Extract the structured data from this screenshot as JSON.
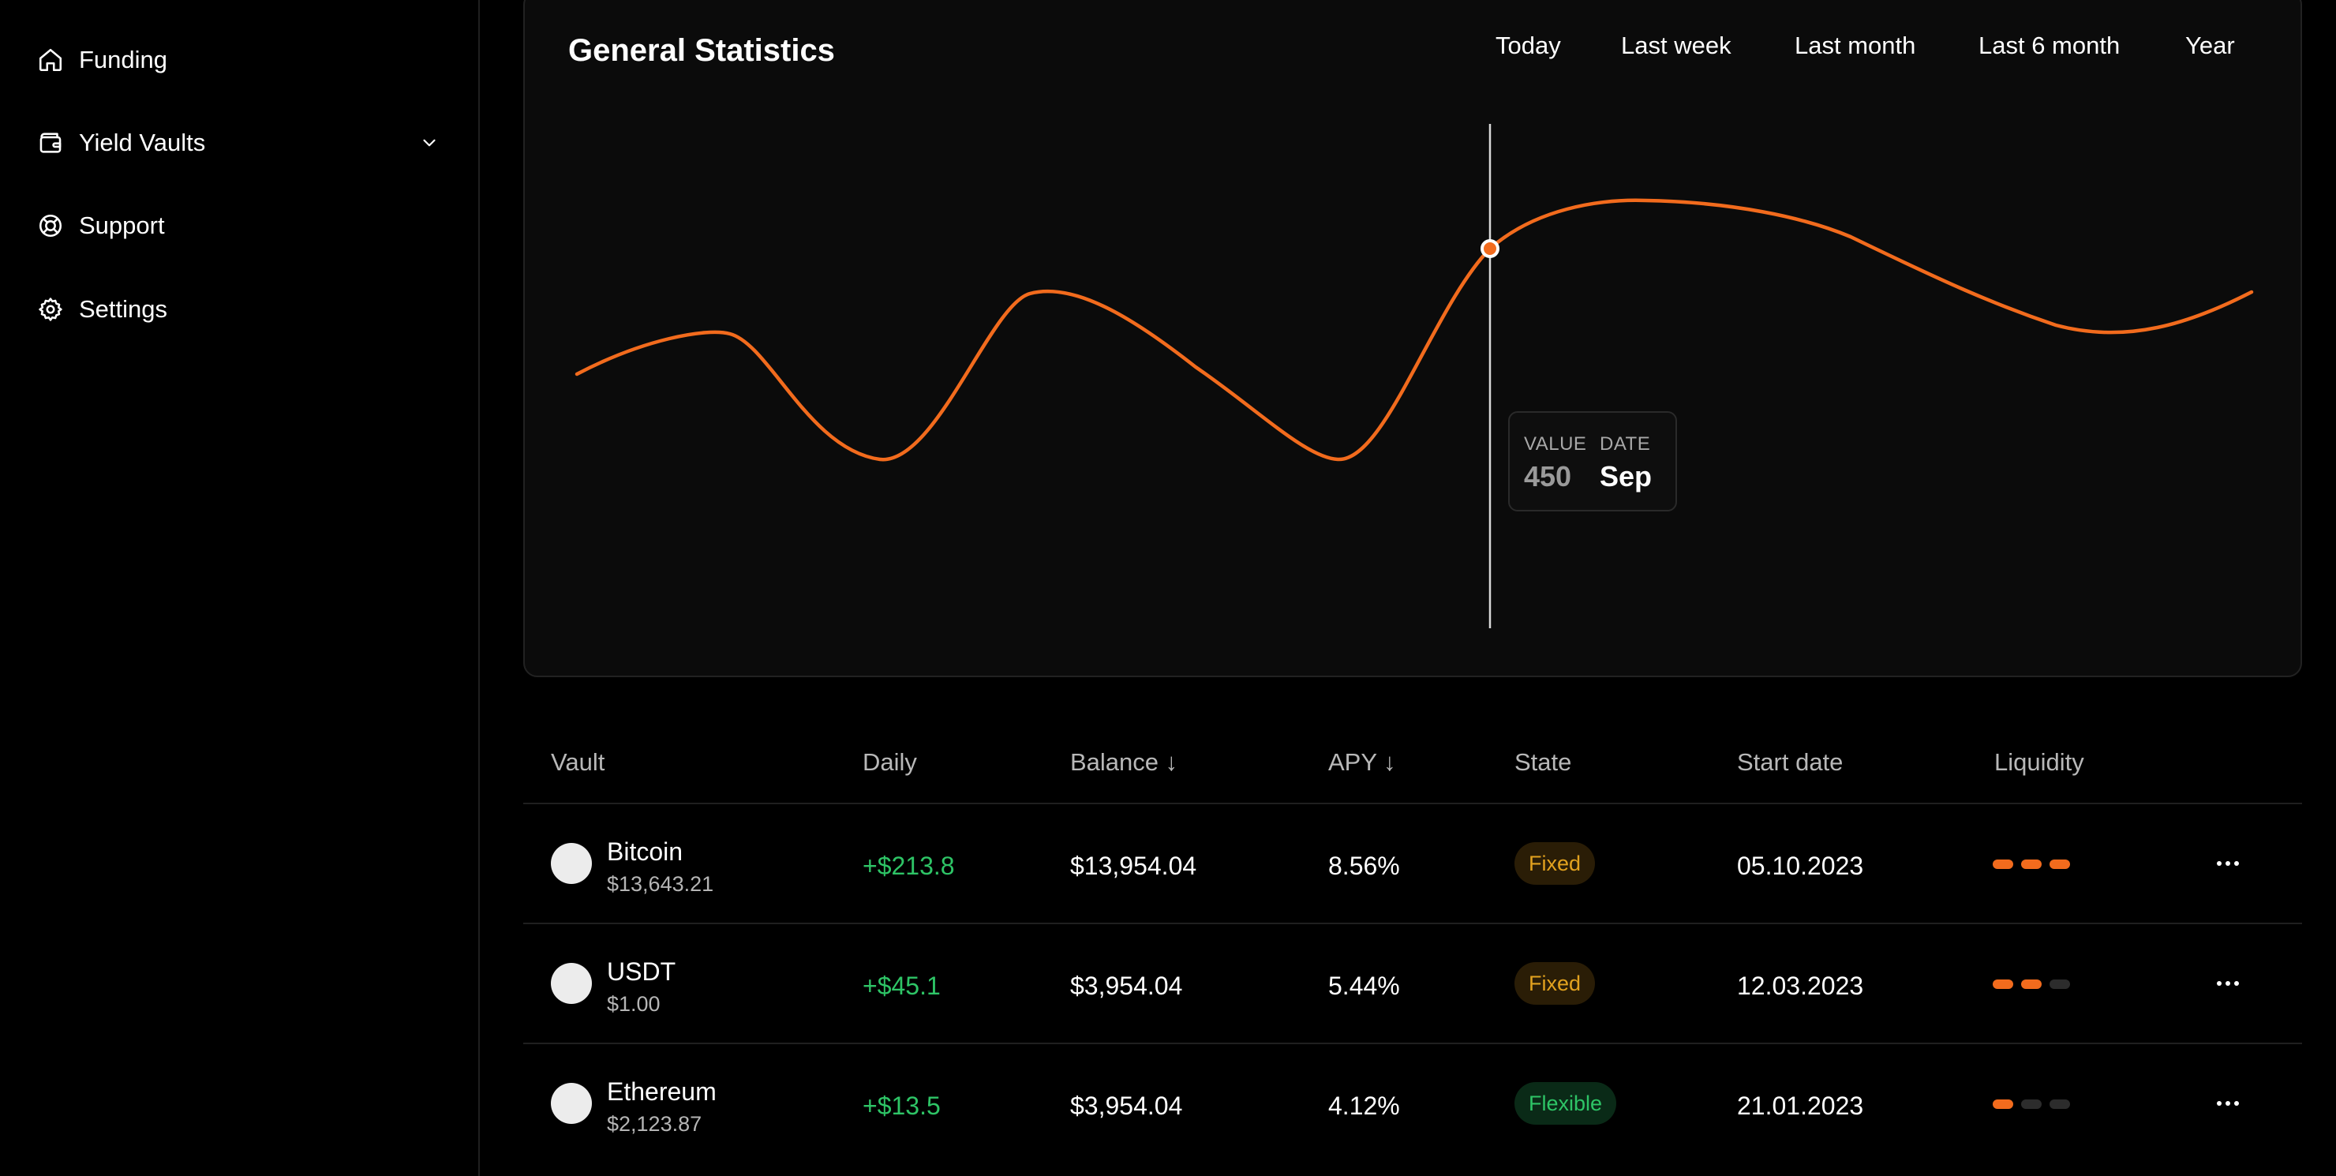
{
  "sidebar": {
    "items": [
      {
        "label": "Funding",
        "icon": "home-icon"
      },
      {
        "label": "Yield Vaults",
        "icon": "wallet-icon"
      },
      {
        "label": "Support",
        "icon": "lifebuoy-icon"
      },
      {
        "label": "Settings",
        "icon": "gear-icon"
      }
    ]
  },
  "stats": {
    "title": "General Statistics",
    "ranges": [
      "Today",
      "Last week",
      "Last month",
      "Last 6 month",
      "Year"
    ],
    "tooltip": {
      "value_label": "VALUE",
      "value": "450",
      "date_label": "DATE",
      "date": "Sep"
    }
  },
  "colors": {
    "accent": "#f26b1d",
    "positive": "#2ec466",
    "fixed": "#e2a21f",
    "background": "#000000",
    "card": "#0b0b0b"
  },
  "table": {
    "headers": {
      "vault": "Vault",
      "daily": "Daily",
      "balance": "Balance ↓",
      "apy": "APY ↓",
      "state": "State",
      "start_date": "Start date",
      "liquidity": "Liquidity"
    },
    "rows": [
      {
        "name": "Bitcoin",
        "price": "$13,643.21",
        "daily": "+$213.8",
        "balance": "$13,954.04",
        "apy": "8.56%",
        "state": "Fixed",
        "start_date": "05.10.2023",
        "liquidity": 3
      },
      {
        "name": "USDT",
        "price": "$1.00",
        "daily": "+$45.1",
        "balance": "$3,954.04",
        "apy": "5.44%",
        "state": "Fixed",
        "start_date": "12.03.2023",
        "liquidity": 2
      },
      {
        "name": "Ethereum",
        "price": "$2,123.87",
        "daily": "+$13.5",
        "balance": "$3,954.04",
        "apy": "4.12%",
        "state": "Flexible",
        "start_date": "21.01.2023",
        "liquidity": 1
      }
    ]
  }
}
